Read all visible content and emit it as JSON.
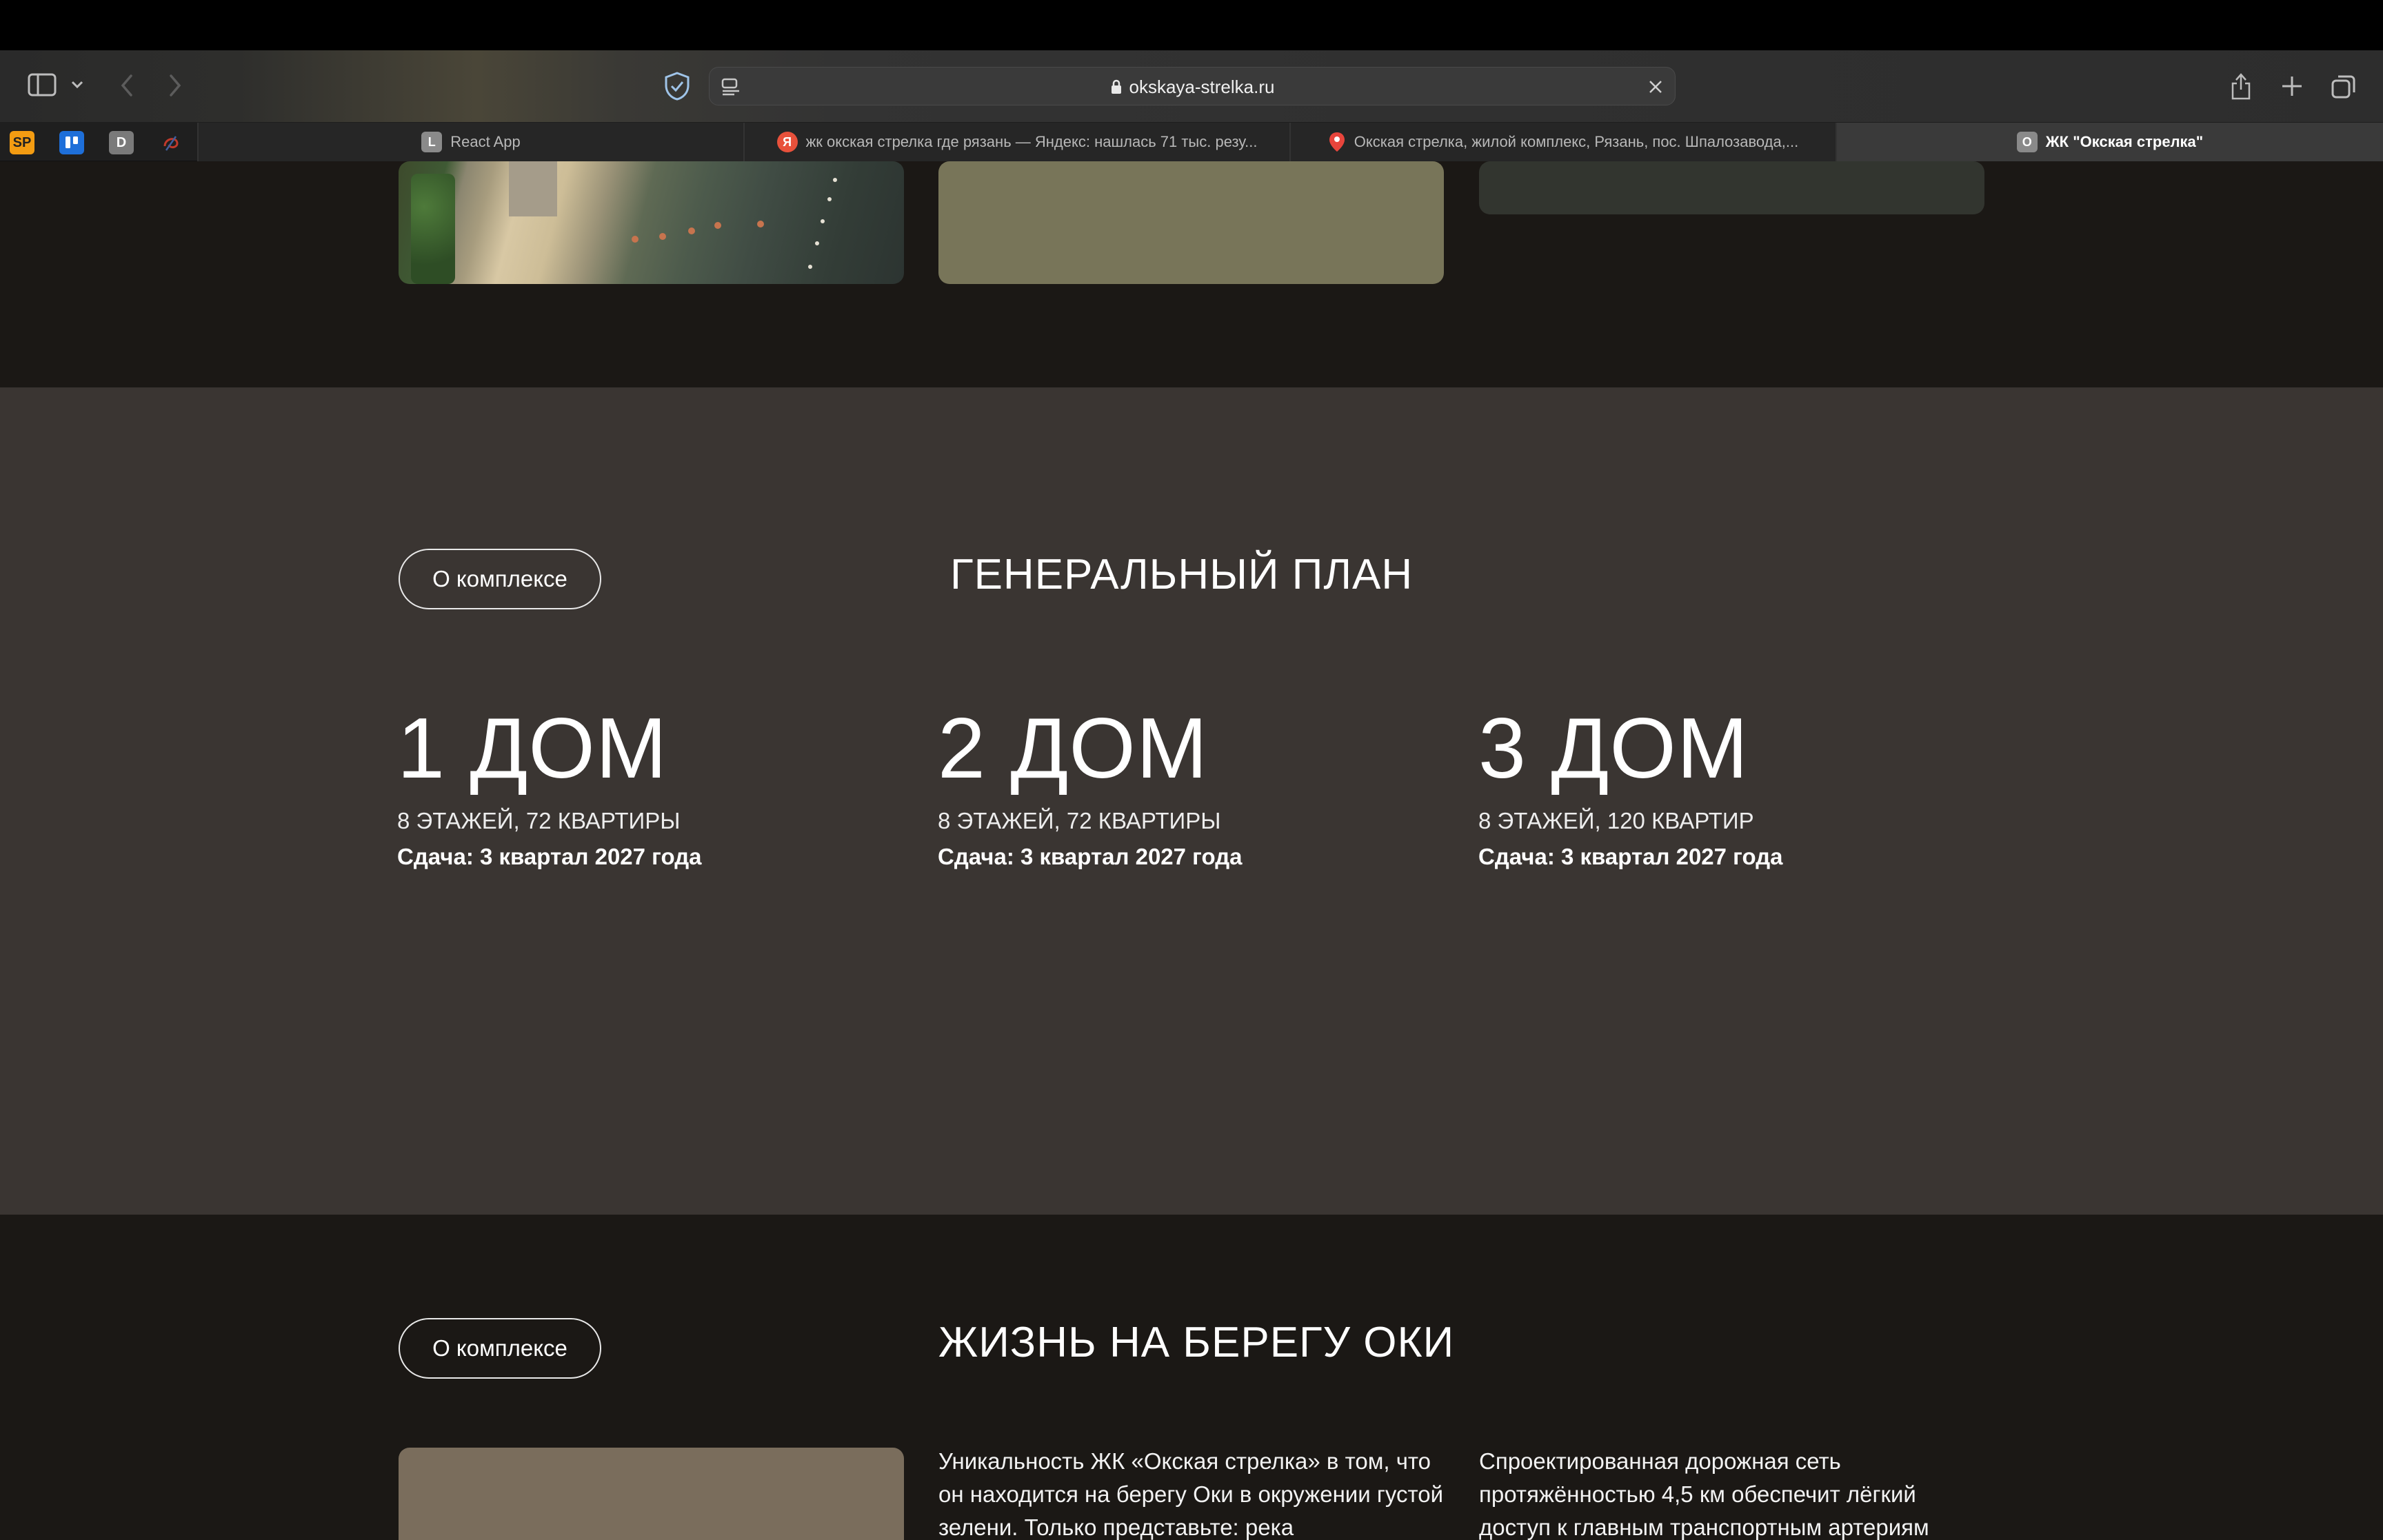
{
  "browser": {
    "url": "okskaya-strelka.ru",
    "pinned_tabs": [
      {
        "name": "sp",
        "label": "SP",
        "color": "#f39c12"
      },
      {
        "name": "trello",
        "label": "",
        "color": "#1e6fd9"
      },
      {
        "name": "d",
        "label": "D",
        "color": "#7a7a7a"
      },
      {
        "name": "swirl",
        "label": "",
        "color": "#c0392b"
      }
    ],
    "tabs": [
      {
        "title": "React App",
        "favicon": "L",
        "active": false
      },
      {
        "title": "жк окская стрелка где рязань — Яндекс: нашлась 71 тыс. резу...",
        "favicon": "Я",
        "active": false
      },
      {
        "title": "Окская стрелка, жилой комплекс, Рязань, пос. Шпалозавода,...",
        "favicon": "map-pin",
        "active": false
      },
      {
        "title": "ЖК \"Окская стрелка\"",
        "favicon": "O",
        "active": true
      }
    ]
  },
  "plan_section": {
    "pill_label": "О комплексе",
    "title": "ГЕНЕРАЛЬНЫЙ ПЛАН",
    "houses": [
      {
        "name": "1 ДОМ",
        "floors": "8 ЭТАЖЕЙ, 72 КВАРТИРЫ",
        "date": "Сдача: 3 квартал 2027 года"
      },
      {
        "name": "2 ДОМ",
        "floors": "8 ЭТАЖЕЙ, 72 КВАРТИРЫ",
        "date": "Сдача: 3 квартал 2027 года"
      },
      {
        "name": "3 ДОМ",
        "floors": "8 ЭТАЖЕЙ, 120 КВАРТИР",
        "date": "Сдача: 3 квартал 2027 года"
      }
    ]
  },
  "life_section": {
    "pill_label": "О комплексе",
    "title": "ЖИЗНЬ НА БЕРЕГУ ОКИ",
    "para1": "Уникальность ЖК «Окская стрелка» в том, что он находится на берегу Оки в окружении густой зелени. Только представьте: река",
    "para2": "Спроектированная дорожная сеть протяжённостью 4,5 км обеспечит лёгкий доступ к главным транспортным артериям"
  },
  "colors": {
    "section_dark": "#1b1815",
    "section_plan": "#3a3532",
    "card_olive": "#787559",
    "card_brown": "#7a6d5c"
  }
}
